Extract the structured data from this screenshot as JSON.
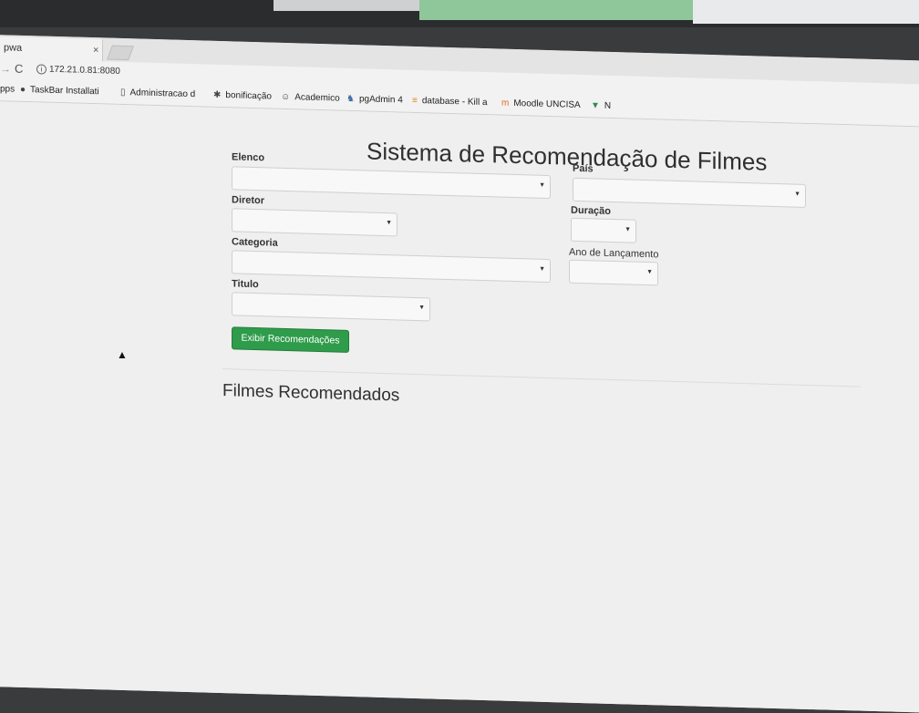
{
  "browser": {
    "tab_title": "pwa",
    "tab_close": "×",
    "address": "172.21.0.81:8080",
    "bookmarks": [
      {
        "label": "pps",
        "icon": "apps-grid-icon"
      },
      {
        "label": "TaskBar Installati",
        "icon": "github-icon"
      },
      {
        "label": "Administracao d",
        "icon": "page-icon"
      },
      {
        "label": "bonificação",
        "icon": "bug-icon"
      },
      {
        "label": "Academico",
        "icon": "user-icon"
      },
      {
        "label": "pgAdmin 4",
        "icon": "elephant-icon"
      },
      {
        "label": "database - Kill a",
        "icon": "stackoverflow-icon"
      },
      {
        "label": "Moodle UNCISA",
        "icon": "moodle-icon"
      },
      {
        "label": "N",
        "icon": "vue-icon"
      }
    ]
  },
  "page": {
    "title": "Sistema de Recomendação de Filmes",
    "filters": {
      "elenco": {
        "label": "Elenco",
        "value": ""
      },
      "diretor": {
        "label": "Diretor",
        "value": ""
      },
      "categoria": {
        "label": "Categoria",
        "value": ""
      },
      "titulo": {
        "label": "Titulo",
        "value": ""
      },
      "pais": {
        "label": "País",
        "value": ""
      },
      "duracao": {
        "label": "Duração",
        "value": ""
      },
      "ano": {
        "label": "Ano de Lançamento",
        "value": ""
      }
    },
    "button_label": "Exibir Recomendações",
    "results_heading": "Filmes Recomendados"
  },
  "colors": {
    "button": "#2e9c4a",
    "page_background": "#efefef"
  }
}
